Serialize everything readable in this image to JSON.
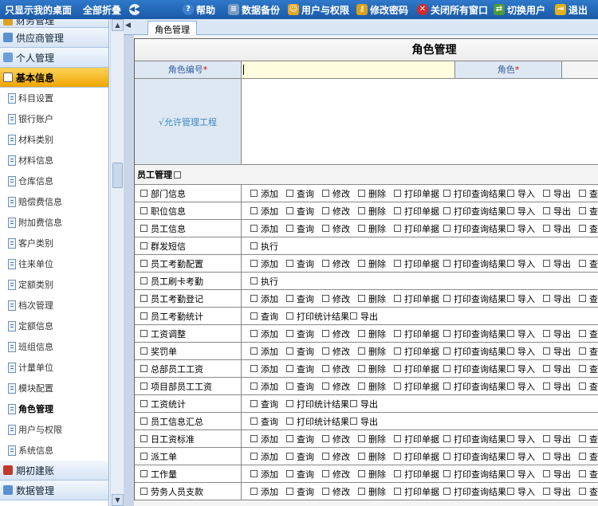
{
  "topbar": {
    "show_desktop": "只显示我的桌面",
    "collapse_all": "全部折叠",
    "help": "帮助",
    "backup": "数据备份",
    "user_perm": "用户与权限",
    "change_pwd": "修改密码",
    "close_all": "关闭所有窗口",
    "switch_user": "切换用户",
    "logout": "退出"
  },
  "sidebar": {
    "top_partial": "财务管理",
    "sections_top": [
      "供应商管理",
      "个人管理"
    ],
    "active_section": "基本信息",
    "items": [
      "科目设置",
      "银行账户",
      "材料类别",
      "材料信息",
      "仓库信息",
      "赔偿费信息",
      "附加费信息",
      "客户类别",
      "往来单位",
      "定额类别",
      "档次管理",
      "定额信息",
      "班组信息",
      "计量单位",
      "模块配置",
      "角色管理",
      "用户与权限",
      "系统信息"
    ],
    "current_item": "角色管理",
    "sections_bottom": [
      "期初建账",
      "数据管理"
    ]
  },
  "tabbar": {
    "tab": "角色管理"
  },
  "panel": {
    "title": "角色管理",
    "role_no_label": "角色编号",
    "role_label": "角色",
    "role_no_value": "",
    "allowed_projects_label": "√允许管理工程",
    "group": "员工管理"
  },
  "ops_w": {
    "添加": 45,
    "查询": 45,
    "修改": 45,
    "删除": 45,
    "打印单据": 62,
    "打印查询结果": 80,
    "导入": 45,
    "导出": 45,
    "执行": 45,
    "打印统计结果": 80
  },
  "perm_rows": [
    {
      "name": "部门信息",
      "ops": [
        "添加",
        "查询",
        "修改",
        "删除",
        "打印单据",
        "打印查询结果",
        "导入",
        "导出",
        "查"
      ]
    },
    {
      "name": "职位信息",
      "ops": [
        "添加",
        "查询",
        "修改",
        "删除",
        "打印单据",
        "打印查询结果",
        "导入",
        "导出",
        "查"
      ]
    },
    {
      "name": "员工信息",
      "ops": [
        "添加",
        "查询",
        "修改",
        "删除",
        "打印单据",
        "打印查询结果",
        "导入",
        "导出",
        "查"
      ]
    },
    {
      "name": "群发短信",
      "ops": [
        "执行"
      ]
    },
    {
      "name": "员工考勤配置",
      "ops": [
        "添加",
        "查询",
        "修改",
        "删除",
        "打印单据",
        "打印查询结果",
        "导入",
        "导出",
        "查"
      ]
    },
    {
      "name": "员工刷卡考勤",
      "ops": [
        "执行"
      ]
    },
    {
      "name": "员工考勤登记",
      "ops": [
        "添加",
        "查询",
        "修改",
        "删除",
        "打印单据",
        "打印查询结果",
        "导入",
        "导出",
        "查"
      ]
    },
    {
      "name": "员工考勤统计",
      "ops": [
        "查询",
        "打印统计结果",
        "导出"
      ]
    },
    {
      "name": "工资调整",
      "ops": [
        "添加",
        "查询",
        "修改",
        "删除",
        "打印单据",
        "打印查询结果",
        "导入",
        "导出",
        "查"
      ]
    },
    {
      "name": "奖罚单",
      "ops": [
        "添加",
        "查询",
        "修改",
        "删除",
        "打印单据",
        "打印查询结果",
        "导入",
        "导出",
        "查"
      ]
    },
    {
      "name": "总部员工工资",
      "ops": [
        "添加",
        "查询",
        "修改",
        "删除",
        "打印单据",
        "打印查询结果",
        "导入",
        "导出",
        "查"
      ]
    },
    {
      "name": "项目部员工工资",
      "ops": [
        "添加",
        "查询",
        "修改",
        "删除",
        "打印单据",
        "打印查询结果",
        "导入",
        "导出",
        "查"
      ]
    },
    {
      "name": "工资统计",
      "ops": [
        "查询",
        "打印统计结果",
        "导出"
      ]
    },
    {
      "name": "员工信息汇总",
      "ops": [
        "查询",
        "打印统计结果",
        "导出"
      ]
    },
    {
      "name": "日工资标准",
      "ops": [
        "添加",
        "查询",
        "修改",
        "删除",
        "打印单据",
        "打印查询结果",
        "导入",
        "导出",
        "查"
      ]
    },
    {
      "name": "派工单",
      "ops": [
        "添加",
        "查询",
        "修改",
        "删除",
        "打印单据",
        "打印查询结果",
        "导入",
        "导出",
        "查"
      ]
    },
    {
      "name": "工作量",
      "ops": [
        "添加",
        "查询",
        "修改",
        "删除",
        "打印单据",
        "打印查询结果",
        "导入",
        "导出",
        "查"
      ]
    },
    {
      "name": "劳务人员支款",
      "ops": [
        "添加",
        "查询",
        "修改",
        "删除",
        "打印单据",
        "打印查询结果",
        "导入",
        "导出",
        "查"
      ]
    }
  ]
}
